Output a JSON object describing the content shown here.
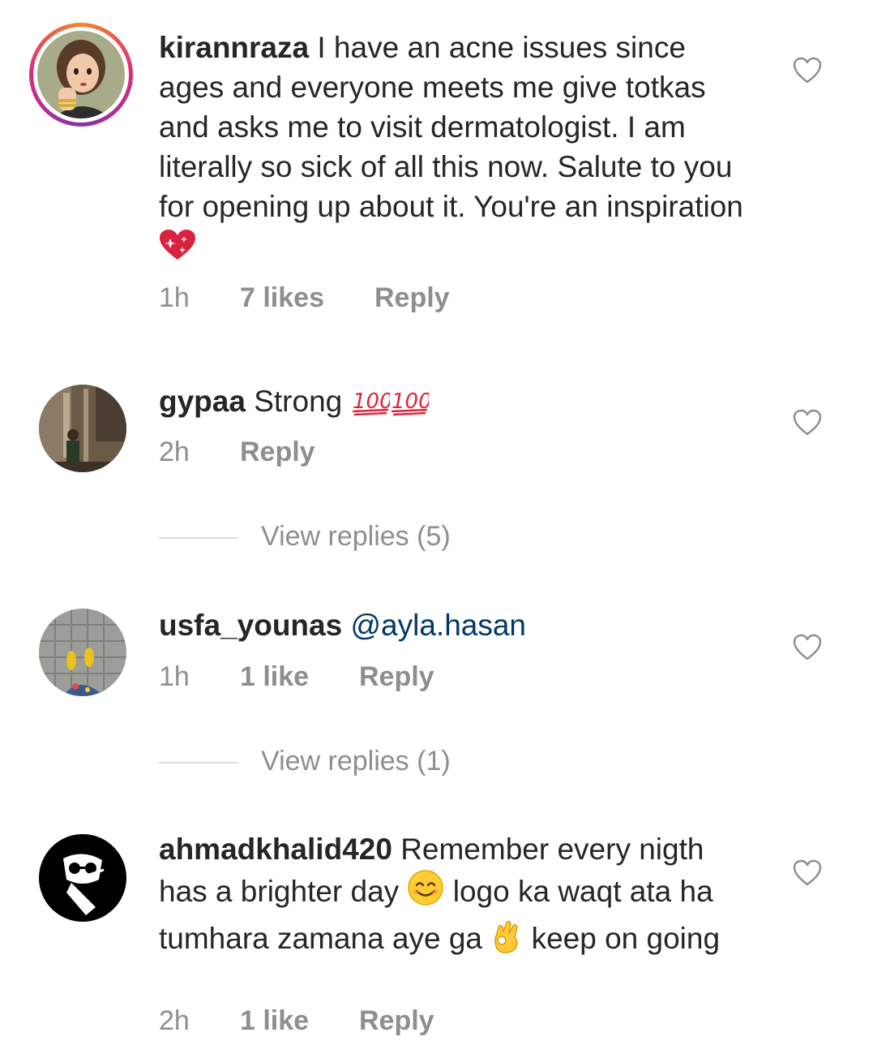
{
  "comments": [
    {
      "username": "kirannraza",
      "text": "I have an acne issues since ages and everyone meets me give totkas and asks me to visit dermatologist. I am literally so sick of all this now. Salute to you for opening up about it. You're an inspiration",
      "time": "1h",
      "likes": "7 likes",
      "reply": "Reply"
    },
    {
      "username": "gypaa",
      "text": "Strong",
      "time": "2h",
      "reply": "Reply",
      "view_replies": "View replies (5)"
    },
    {
      "username": "usfa_younas",
      "mention": "@ayla.hasan",
      "time": "1h",
      "likes": "1 like",
      "reply": "Reply",
      "view_replies": "View replies (1)"
    },
    {
      "username": "ahmadkhalid420",
      "text_part1": "Remember every nigth has a brighter day",
      "text_part2": "logo ka waqt ata ha tumhara zamana aye ga",
      "text_part3": "keep on going",
      "time": "2h",
      "likes": "1 like",
      "reply": "Reply"
    }
  ],
  "icons": {
    "like": "heart-outline-icon",
    "sparkling_heart": "sparkling-heart-emoji",
    "hundred": "hundred-points-emoji",
    "smile": "smiling-face-emoji",
    "ok_hand": "ok-hand-emoji"
  },
  "colors": {
    "text": "#262626",
    "secondary": "#8e8e8e",
    "mention": "#00376b",
    "divider": "#dbdbdb"
  }
}
